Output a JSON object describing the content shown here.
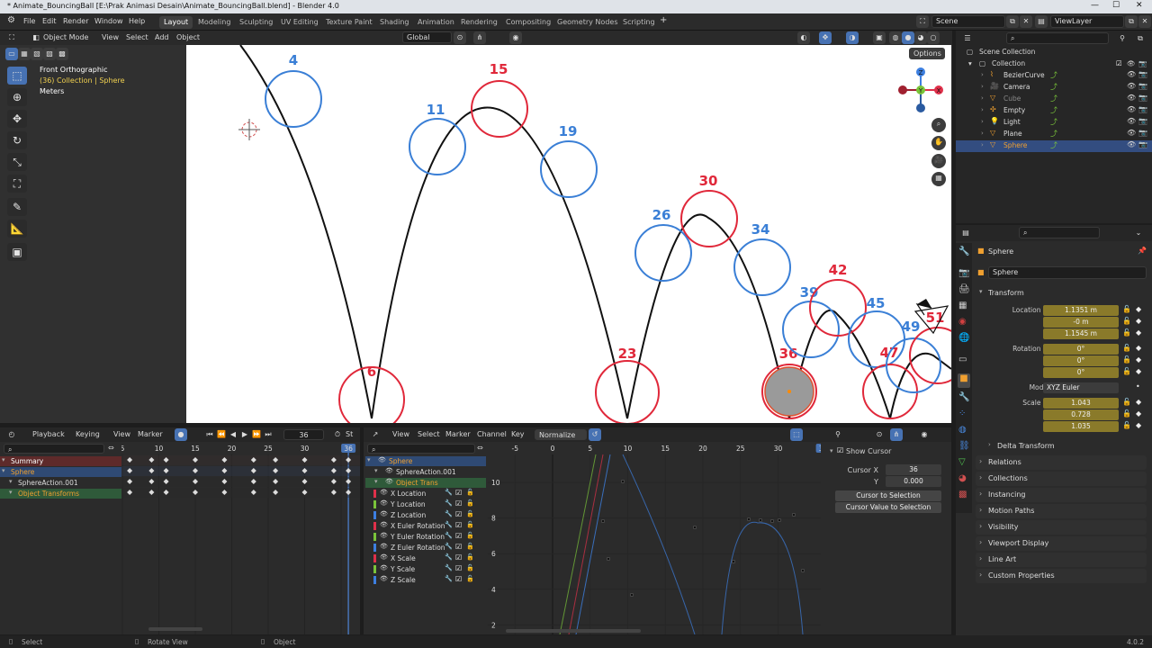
{
  "window": {
    "title": "* Animate_BouncingBall [E:\\Prak Animasi Desain\\Animate_BouncingBall.blend] - Blender 4.0",
    "minimize": "—",
    "maximize": "☐",
    "close": "✕"
  },
  "menu": [
    "File",
    "Edit",
    "Render",
    "Window",
    "Help"
  ],
  "workspaces": [
    "Layout",
    "Modeling",
    "Sculpting",
    "UV Editing",
    "Texture Paint",
    "Shading",
    "Animation",
    "Rendering",
    "Compositing",
    "Geometry Nodes",
    "Scripting"
  ],
  "workspace_add": "+",
  "scene": {
    "label": "Scene",
    "viewlayer": "ViewLayer"
  },
  "viewport": {
    "mode": "Object Mode",
    "menus": [
      "View",
      "Select",
      "Add",
      "Object"
    ],
    "transform_orientation": "Global",
    "options": "Options",
    "overlay_info": {
      "view": "Front Orthographic",
      "collection": "(36) Collection | Sphere",
      "units": "Meters"
    },
    "frame_labels": [
      {
        "text": "4",
        "color": "blue"
      },
      {
        "text": "6",
        "color": "red"
      },
      {
        "text": "11",
        "color": "blue"
      },
      {
        "text": "15",
        "color": "red"
      },
      {
        "text": "19",
        "color": "blue"
      },
      {
        "text": "23",
        "color": "red"
      },
      {
        "text": "26",
        "color": "blue"
      },
      {
        "text": "30",
        "color": "red"
      },
      {
        "text": "34",
        "color": "blue"
      },
      {
        "text": "36",
        "color": "red"
      },
      {
        "text": "39",
        "color": "blue"
      },
      {
        "text": "42",
        "color": "red"
      },
      {
        "text": "45",
        "color": "blue"
      },
      {
        "text": "47",
        "color": "red"
      },
      {
        "text": "49",
        "color": "blue"
      },
      {
        "text": "51",
        "color": "red"
      }
    ],
    "gizmo_axes": {
      "x": "X",
      "y": "Y",
      "z": "Z"
    }
  },
  "outliner": {
    "search_placeholder": "",
    "root": "Scene Collection",
    "collection": "Collection",
    "items": [
      {
        "name": "BezierCurve",
        "icon": "curve-icon",
        "selected": false
      },
      {
        "name": "Camera",
        "icon": "camera-icon",
        "selected": false
      },
      {
        "name": "Cube",
        "icon": "mesh-icon",
        "selected": false,
        "dimmed": true
      },
      {
        "name": "Empty",
        "icon": "empty-icon",
        "selected": false
      },
      {
        "name": "Light",
        "icon": "light-icon",
        "selected": false
      },
      {
        "name": "Plane",
        "icon": "mesh-icon",
        "selected": false
      },
      {
        "name": "Sphere",
        "icon": "mesh-icon",
        "selected": true
      }
    ]
  },
  "properties": {
    "object_name": "Sphere",
    "data_name": "Sphere",
    "transform_header": "Transform",
    "location": {
      "label": "Location X",
      "x": "1.1351 m",
      "y": "-0 m",
      "z": "1.1545 m"
    },
    "rotation": {
      "label": "Rotation X",
      "x": "0°",
      "y": "0°",
      "z": "0°"
    },
    "mode": {
      "label": "Mode",
      "value": "XYZ Euler"
    },
    "scale": {
      "label": "Scale X",
      "x": "1.043",
      "y": "0.728",
      "z": "1.035"
    },
    "axis_labels": {
      "y": "Y",
      "z": "Z"
    },
    "delta": "Delta Transform",
    "sections": [
      "Relations",
      "Collections",
      "Instancing",
      "Motion Paths",
      "Visibility",
      "Viewport Display",
      "Line Art",
      "Custom Properties"
    ]
  },
  "dopesheet": {
    "menus": [
      "Playback",
      "Keying",
      "View",
      "Marker"
    ],
    "current_frame": "36",
    "start_label": "St",
    "ruler": [
      "5",
      "10",
      "15",
      "20",
      "25",
      "30",
      "36"
    ],
    "channels": [
      {
        "name": "Summary",
        "kind": "summary"
      },
      {
        "name": "Sphere",
        "kind": "object"
      },
      {
        "name": "SphereAction.001",
        "kind": "action"
      },
      {
        "name": "Object Transforms",
        "kind": "group"
      }
    ]
  },
  "graph": {
    "menus": [
      "View",
      "Select",
      "Marker",
      "Channel",
      "Key"
    ],
    "normalize": "Normalize",
    "ruler": [
      "-5",
      "0",
      "5",
      "10",
      "15",
      "20",
      "25",
      "30",
      "36"
    ],
    "y_ticks": [
      "10",
      "8",
      "6",
      "4",
      "2"
    ],
    "object": "Sphere",
    "action": "SphereAction.001",
    "group": "Object Trans",
    "channels": [
      {
        "name": "X Location",
        "color": "#e0304a"
      },
      {
        "name": "Y Location",
        "color": "#7ac43a"
      },
      {
        "name": "Z Location",
        "color": "#3d7fe0"
      },
      {
        "name": "X Euler Rotation",
        "color": "#e0304a"
      },
      {
        "name": "Y Euler Rotation",
        "color": "#7ac43a"
      },
      {
        "name": "Z Euler Rotation",
        "color": "#3d7fe0"
      },
      {
        "name": "X Scale",
        "color": "#e0304a"
      },
      {
        "name": "Y Scale",
        "color": "#7ac43a"
      },
      {
        "name": "Z Scale",
        "color": "#3d7fe0"
      }
    ],
    "sidebar": {
      "show_cursor": "Show Cursor",
      "cursor_x_label": "Cursor X",
      "cursor_x": "36",
      "cursor_y_label": "Y",
      "cursor_y": "0.000",
      "to_selection": "Cursor to Selection",
      "value_to_selection": "Cursor Value to Selection"
    }
  },
  "status": {
    "select": "Select",
    "rotate": "Rotate View",
    "object": "Object",
    "version": "4.0.2"
  },
  "colors": {
    "accent": "#4772b3",
    "red_label": "#e0283a",
    "blue_label": "#3a7fd6",
    "keyed_field": "#8a7a2a"
  }
}
